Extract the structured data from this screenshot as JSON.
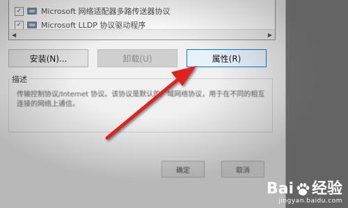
{
  "component_list": {
    "items": [
      {
        "checked": true,
        "label": "Microsoft 网络适配器多路传送器协议"
      },
      {
        "checked": true,
        "label": "Microsoft LLDP 协议驱动程序"
      }
    ]
  },
  "buttons": {
    "install": "安装(N)...",
    "uninstall": "卸载(U)",
    "properties": "属性(R)"
  },
  "description": {
    "label": "描述",
    "text": "传输控制协议/Internet 协议。该协议是默认的广域网络协议，用于在不同的相互连接的网络上通信。"
  },
  "dialog_buttons": {
    "ok": "确定",
    "cancel": "取消"
  },
  "watermark": {
    "brand_left": "Bai",
    "brand_right": "经验",
    "url": "jingyan.baidu.com"
  },
  "colors": {
    "arrow": "#e0201b",
    "focus_border": "#0078d7",
    "dialog_bg": "#f0f0f0"
  },
  "icons": [
    "checkbox-icon",
    "network-protocol-icon",
    "scroll-left-icon",
    "scroll-right-icon",
    "baidu-paw-icon"
  ]
}
